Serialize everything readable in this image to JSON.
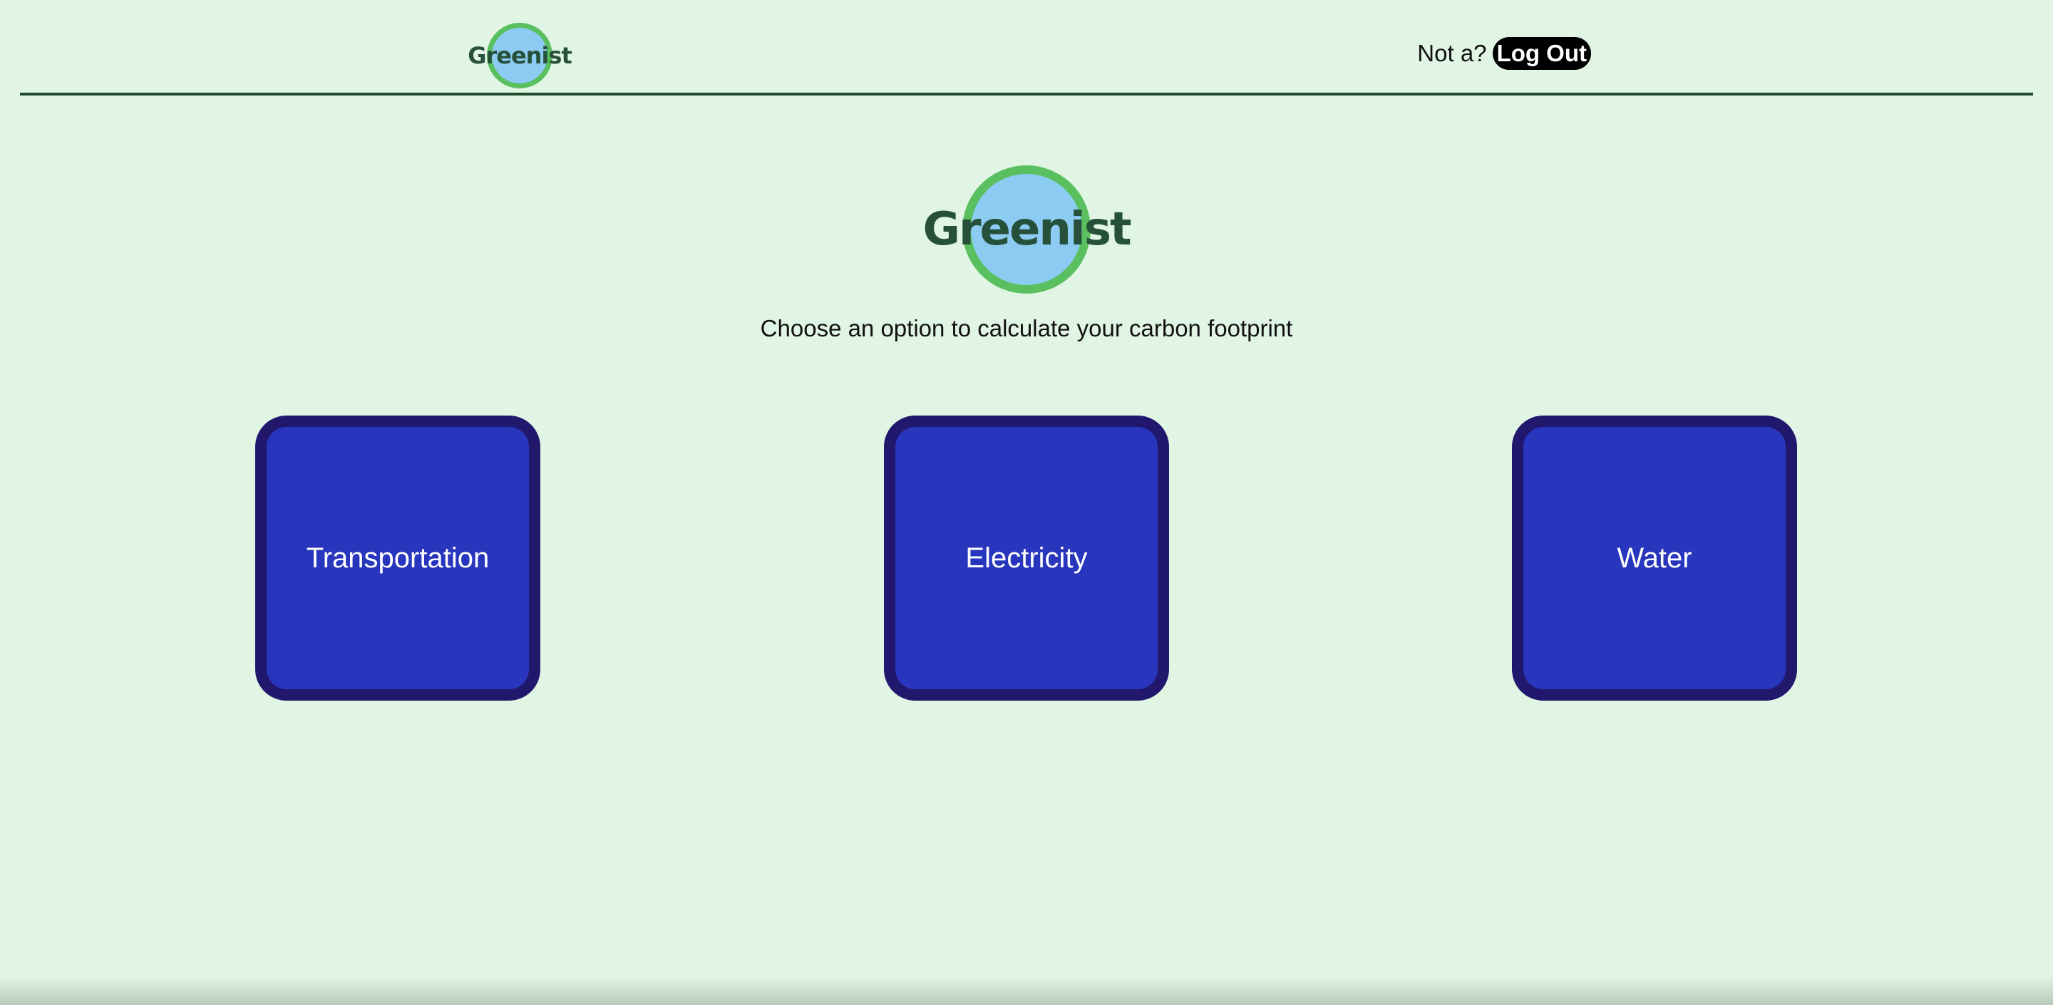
{
  "header": {
    "logo_text": "Greenist",
    "user_prompt": "Not a?",
    "logout_label": "Log Out"
  },
  "hero": {
    "logo_text": "Greenist",
    "subtitle": "Choose an option to calculate your carbon footprint"
  },
  "options": [
    {
      "label": "Transportation"
    },
    {
      "label": "Electricity"
    },
    {
      "label": "Water"
    }
  ],
  "colors": {
    "background": "#e1f5e4",
    "header_rule": "#1f4a2c",
    "logo_circle_fill": "#8dccf2",
    "logo_circle_border": "#5abf5e",
    "logo_text": "#27503a",
    "card_fill": "#2736bc",
    "card_border": "#21186e",
    "logout_bg": "#000000"
  }
}
